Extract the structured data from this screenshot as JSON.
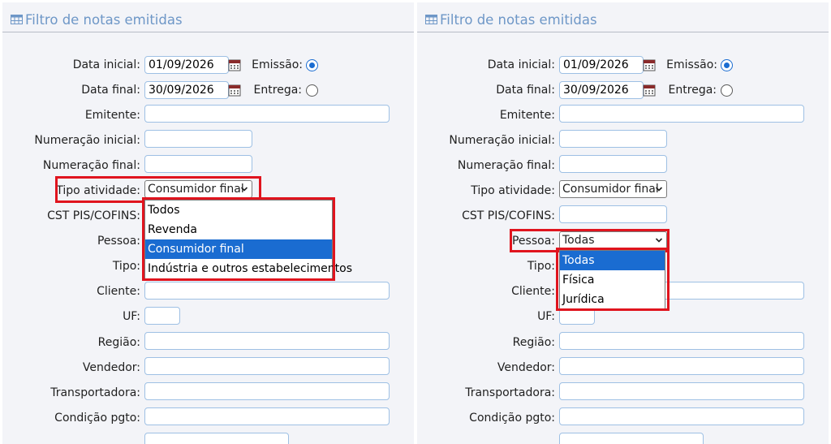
{
  "left": {
    "title": "Filtro de notas emitidas",
    "labels": {
      "data_inicial": "Data inicial:",
      "data_final": "Data final:",
      "emissao": "Emissão:",
      "entrega": "Entrega:",
      "emitente": "Emitente:",
      "numeracao_inicial": "Numeração inicial:",
      "numeracao_final": "Numeração final:",
      "tipo_atividade": "Tipo atividade:",
      "cst": "CST PIS/COFINS:",
      "pessoa": "Pessoa:",
      "tipo": "Tipo:",
      "cliente": "Cliente:",
      "uf": "UF:",
      "regiao": "Região:",
      "vendedor": "Vendedor:",
      "transportadora": "Transportadora:",
      "condicao": "Condição pgto:"
    },
    "values": {
      "data_inicial": "01/09/2026",
      "data_final": "30/09/2026",
      "tipo_atividade": "Consumidor final"
    },
    "dropdown": [
      "Todos",
      "Revenda",
      "Consumidor final",
      "Indústria e outros estabelecimentos"
    ],
    "dropdown_selected": "Consumidor final"
  },
  "right": {
    "title": "Filtro de notas emitidas",
    "labels": {
      "data_inicial": "Data inicial:",
      "data_final": "Data final:",
      "emissao": "Emissão:",
      "entrega": "Entrega:",
      "emitente": "Emitente:",
      "numeracao_inicial": "Numeração inicial:",
      "numeracao_final": "Numeração final:",
      "tipo_atividade": "Tipo atividade:",
      "cst": "CST PIS/COFINS:",
      "pessoa": "Pessoa:",
      "tipo": "Tipo:",
      "cliente": "Cliente:",
      "uf": "UF:",
      "regiao": "Região:",
      "vendedor": "Vendedor:",
      "transportadora": "Transportadora:",
      "condicao": "Condição pgto:"
    },
    "values": {
      "data_inicial": "01/09/2026",
      "data_final": "30/09/2026",
      "tipo_atividade": "Consumidor final",
      "pessoa": "Todas"
    },
    "dropdown": [
      "Todas",
      "Física",
      "Jurídica"
    ],
    "dropdown_selected": "Todas"
  },
  "icons": {
    "header": "table-grid-icon",
    "calendar": "calendar-icon",
    "chevron": "chevron-down-icon"
  },
  "colors": {
    "header_text": "#6e97c7",
    "highlight": "#e0141e",
    "selected_option": "#1a6cd1",
    "input_border": "#9ec0e4"
  }
}
